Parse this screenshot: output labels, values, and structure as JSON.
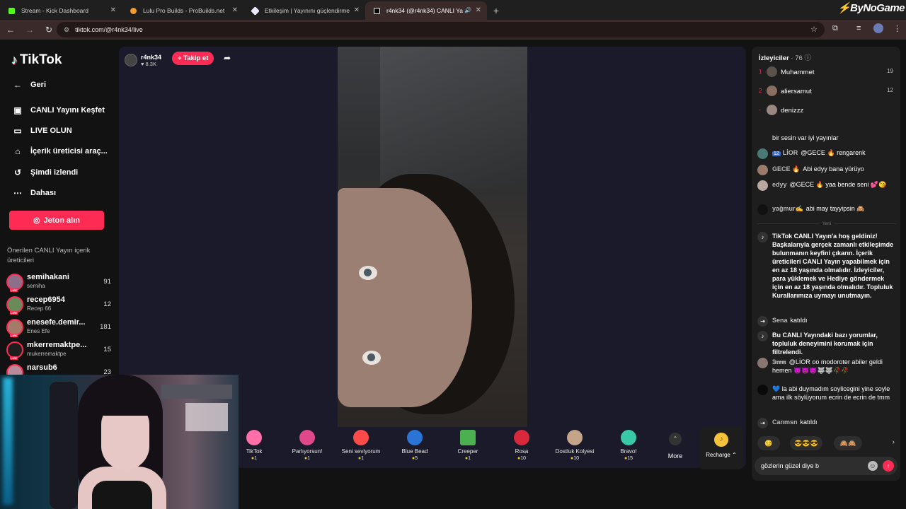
{
  "browser": {
    "tabs": [
      {
        "title": "Stream - Kick Dashboard",
        "favicon_color": "#53fc18"
      },
      {
        "title": "Lulu Pro Builds - ProBuilds.net",
        "favicon_color": "#f29a2e"
      },
      {
        "title": "Etkileşim | Yayınını güçlendirme",
        "favicon_color": "#e9e9ff"
      },
      {
        "title": "r4nk34 (@r4nk34) CANLI Ya",
        "favicon_color": "#ffffff"
      }
    ],
    "url": "tiktok.com/@r4nk34/live",
    "watermark": "ByNoGame"
  },
  "sidebar": {
    "logo": "TikTok",
    "nav": [
      {
        "label": "Geri",
        "icon": "back-arrow-icon"
      },
      {
        "label": "CANLI Yayını Keşfet",
        "icon": "live-tv-icon"
      },
      {
        "label": "LIVE OLUN",
        "icon": "camera-icon"
      },
      {
        "label": "İçerik üreticisi araç...",
        "icon": "creator-tools-icon"
      },
      {
        "label": "Şimdi izlendi",
        "icon": "history-icon"
      },
      {
        "label": "Dahası",
        "icon": "more-dots-icon"
      }
    ],
    "coins_button": "Jeton alın",
    "recommended_title": "Önerilen CANLI Yayın içerik üreticileri",
    "creators": [
      {
        "name": "semihakani",
        "sub": "semiha",
        "count": "91"
      },
      {
        "name": "recep6954",
        "sub": "Recep 66",
        "count": "12"
      },
      {
        "name": "enesefe.demir...",
        "sub": "Enes Efe",
        "count": "181"
      },
      {
        "name": "mkerremaktpe...",
        "sub": "mukerremaktpe",
        "count": "15"
      },
      {
        "name": "narsub6",
        "sub": "",
        "count": "23"
      }
    ],
    "live_badge": "LIVE"
  },
  "stage": {
    "host_name": "r4nk34",
    "host_likes": "♥ 8.3K",
    "follow_button": "+ Takip et"
  },
  "gifts": [
    {
      "name": "TikTok",
      "price": "1",
      "color": "#ff6fa8"
    },
    {
      "name": "Parlıyorsun!",
      "price": "1",
      "color": "#e0488a"
    },
    {
      "name": "Seni seviyorum",
      "price": "1",
      "color": "#ff4a4a"
    },
    {
      "name": "Blue Bead",
      "price": "5",
      "color": "#2a74d6"
    },
    {
      "name": "Creeper",
      "price": "1",
      "color": "#4caf50"
    },
    {
      "name": "Rosa",
      "price": "10",
      "color": "#d8283c"
    },
    {
      "name": "Dostluk Kolyesi",
      "price": "10",
      "color": "#c4a58a"
    },
    {
      "name": "Bravo!",
      "price": "15",
      "color": "#38c8a8"
    }
  ],
  "more_label": "More",
  "recharge_label": "Recharge",
  "panel": {
    "viewers_title": "İzleyiciler",
    "viewers_count": "· 76",
    "viewers": [
      {
        "rank": "1",
        "name": "Muhammet",
        "score": "19"
      },
      {
        "rank": "2",
        "name": "aliersamut",
        "score": "12"
      },
      {
        "rank": "-",
        "name": "denizzz",
        "score": ""
      }
    ],
    "chat": [
      {
        "user": "",
        "text": "bir sesin var iyi yayınlar"
      },
      {
        "user": "LİOR",
        "level": "12",
        "text": "@GECE 🔥 rengarenk"
      },
      {
        "user": "GECE 🔥",
        "text": "Abi edyy bana yürüyo"
      },
      {
        "user": "edyy",
        "text": "@GECE 🔥 yaa bende seni 💕😘"
      },
      {
        "user": "yağmur✍",
        "text": "abi may tayyipsin 🙈"
      }
    ],
    "new_divider": "Yeni",
    "welcome": "TikTok CANLI Yayın'a hoş geldiniz! Başkalarıyla gerçek zamanlı etkileşimde bulunmanın keyfini çıkarın. İçerik üreticileri CANLI Yayın yapabilmek için en az 18 yaşında olmalıdır. İzleyiciler, para yüklemek ve Hediye göndermek için en az 18 yaşında olmalıdır. Topluluk Kurallarımıza uymayı unutmayın.",
    "joined1_user": "Sena",
    "joined_text": "katıldı",
    "filter_notice": "Bu CANLI Yayındaki bazı yorumlar, topluluk deneyimini korumak için filtrelendi.",
    "msg_irem_user": "𝕴𝖗𝖊𝖒",
    "msg_irem_text": "@LİOR oo modoroter abiler geldi hemen 👿👿👿🐺🐺🥀🥀",
    "msg_blue_text": "💙 la abi duymadım soylicegini yine soyle ama ilk söylüyorum ecrin de ecrin de tmm",
    "joined2_user": "Canmsn",
    "quick_emojis": [
      "😏",
      "😎😎😎",
      "🙈🙈"
    ],
    "input_value": "gözlerin güzel diye b"
  }
}
